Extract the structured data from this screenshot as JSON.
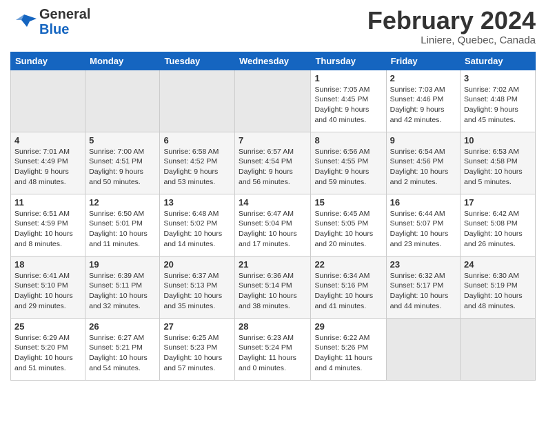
{
  "header": {
    "logo_line1": "General",
    "logo_line2": "Blue",
    "month": "February 2024",
    "location": "Liniere, Quebec, Canada"
  },
  "columns": [
    "Sunday",
    "Monday",
    "Tuesday",
    "Wednesday",
    "Thursday",
    "Friday",
    "Saturday"
  ],
  "weeks": [
    [
      {
        "day": "",
        "info": ""
      },
      {
        "day": "",
        "info": ""
      },
      {
        "day": "",
        "info": ""
      },
      {
        "day": "",
        "info": ""
      },
      {
        "day": "1",
        "info": "Sunrise: 7:05 AM\nSunset: 4:45 PM\nDaylight: 9 hours\nand 40 minutes."
      },
      {
        "day": "2",
        "info": "Sunrise: 7:03 AM\nSunset: 4:46 PM\nDaylight: 9 hours\nand 42 minutes."
      },
      {
        "day": "3",
        "info": "Sunrise: 7:02 AM\nSunset: 4:48 PM\nDaylight: 9 hours\nand 45 minutes."
      }
    ],
    [
      {
        "day": "4",
        "info": "Sunrise: 7:01 AM\nSunset: 4:49 PM\nDaylight: 9 hours\nand 48 minutes."
      },
      {
        "day": "5",
        "info": "Sunrise: 7:00 AM\nSunset: 4:51 PM\nDaylight: 9 hours\nand 50 minutes."
      },
      {
        "day": "6",
        "info": "Sunrise: 6:58 AM\nSunset: 4:52 PM\nDaylight: 9 hours\nand 53 minutes."
      },
      {
        "day": "7",
        "info": "Sunrise: 6:57 AM\nSunset: 4:54 PM\nDaylight: 9 hours\nand 56 minutes."
      },
      {
        "day": "8",
        "info": "Sunrise: 6:56 AM\nSunset: 4:55 PM\nDaylight: 9 hours\nand 59 minutes."
      },
      {
        "day": "9",
        "info": "Sunrise: 6:54 AM\nSunset: 4:56 PM\nDaylight: 10 hours\nand 2 minutes."
      },
      {
        "day": "10",
        "info": "Sunrise: 6:53 AM\nSunset: 4:58 PM\nDaylight: 10 hours\nand 5 minutes."
      }
    ],
    [
      {
        "day": "11",
        "info": "Sunrise: 6:51 AM\nSunset: 4:59 PM\nDaylight: 10 hours\nand 8 minutes."
      },
      {
        "day": "12",
        "info": "Sunrise: 6:50 AM\nSunset: 5:01 PM\nDaylight: 10 hours\nand 11 minutes."
      },
      {
        "day": "13",
        "info": "Sunrise: 6:48 AM\nSunset: 5:02 PM\nDaylight: 10 hours\nand 14 minutes."
      },
      {
        "day": "14",
        "info": "Sunrise: 6:47 AM\nSunset: 5:04 PM\nDaylight: 10 hours\nand 17 minutes."
      },
      {
        "day": "15",
        "info": "Sunrise: 6:45 AM\nSunset: 5:05 PM\nDaylight: 10 hours\nand 20 minutes."
      },
      {
        "day": "16",
        "info": "Sunrise: 6:44 AM\nSunset: 5:07 PM\nDaylight: 10 hours\nand 23 minutes."
      },
      {
        "day": "17",
        "info": "Sunrise: 6:42 AM\nSunset: 5:08 PM\nDaylight: 10 hours\nand 26 minutes."
      }
    ],
    [
      {
        "day": "18",
        "info": "Sunrise: 6:41 AM\nSunset: 5:10 PM\nDaylight: 10 hours\nand 29 minutes."
      },
      {
        "day": "19",
        "info": "Sunrise: 6:39 AM\nSunset: 5:11 PM\nDaylight: 10 hours\nand 32 minutes."
      },
      {
        "day": "20",
        "info": "Sunrise: 6:37 AM\nSunset: 5:13 PM\nDaylight: 10 hours\nand 35 minutes."
      },
      {
        "day": "21",
        "info": "Sunrise: 6:36 AM\nSunset: 5:14 PM\nDaylight: 10 hours\nand 38 minutes."
      },
      {
        "day": "22",
        "info": "Sunrise: 6:34 AM\nSunset: 5:16 PM\nDaylight: 10 hours\nand 41 minutes."
      },
      {
        "day": "23",
        "info": "Sunrise: 6:32 AM\nSunset: 5:17 PM\nDaylight: 10 hours\nand 44 minutes."
      },
      {
        "day": "24",
        "info": "Sunrise: 6:30 AM\nSunset: 5:19 PM\nDaylight: 10 hours\nand 48 minutes."
      }
    ],
    [
      {
        "day": "25",
        "info": "Sunrise: 6:29 AM\nSunset: 5:20 PM\nDaylight: 10 hours\nand 51 minutes."
      },
      {
        "day": "26",
        "info": "Sunrise: 6:27 AM\nSunset: 5:21 PM\nDaylight: 10 hours\nand 54 minutes."
      },
      {
        "day": "27",
        "info": "Sunrise: 6:25 AM\nSunset: 5:23 PM\nDaylight: 10 hours\nand 57 minutes."
      },
      {
        "day": "28",
        "info": "Sunrise: 6:23 AM\nSunset: 5:24 PM\nDaylight: 11 hours\nand 0 minutes."
      },
      {
        "day": "29",
        "info": "Sunrise: 6:22 AM\nSunset: 5:26 PM\nDaylight: 11 hours\nand 4 minutes."
      },
      {
        "day": "",
        "info": ""
      },
      {
        "day": "",
        "info": ""
      }
    ]
  ]
}
